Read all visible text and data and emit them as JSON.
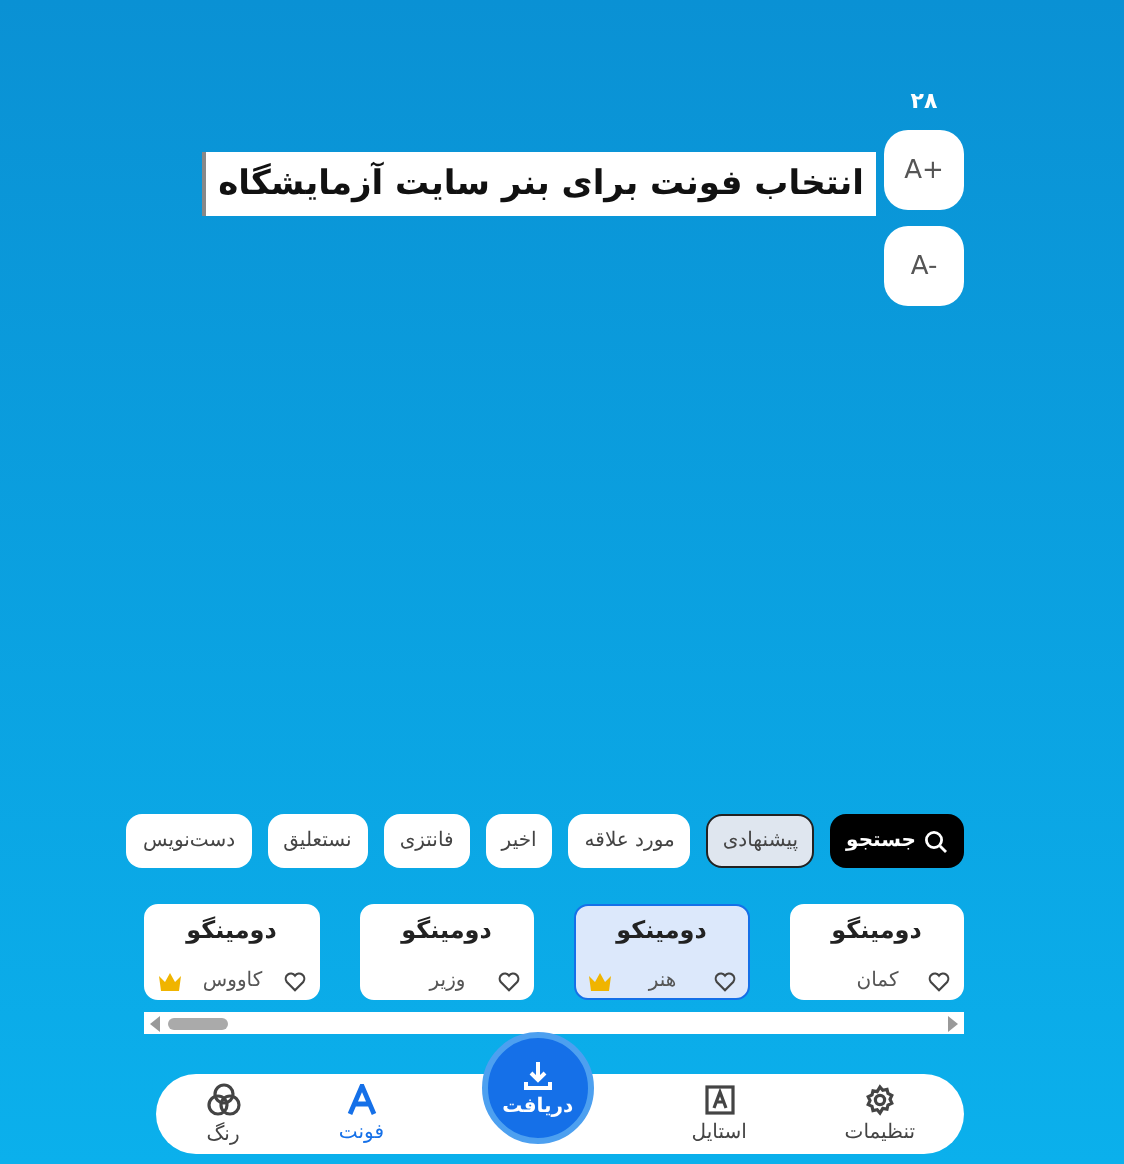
{
  "font_size": "۲۸",
  "preview_text": "انتخاب فونت برای بنر سایت آزمایشگاه",
  "size_buttons": [
    "A+",
    "A-"
  ],
  "search_button": "جستجو",
  "categories": [
    {
      "label": "پیشنهادی",
      "selected": true
    },
    {
      "label": "مورد علاقه",
      "selected": false
    },
    {
      "label": "اخیر",
      "selected": false
    },
    {
      "label": "فانتزی",
      "selected": false
    },
    {
      "label": "نستعلیق",
      "selected": false
    },
    {
      "label": "دست‌نویس",
      "selected": false
    }
  ],
  "fonts": [
    {
      "name": "دومینگو",
      "style": "کمان",
      "selected": false,
      "premium": false
    },
    {
      "name": "دومینکو",
      "style": "هنر",
      "selected": true,
      "premium": true
    },
    {
      "name": "دومینگو",
      "style": "وزیر",
      "selected": false,
      "premium": false
    },
    {
      "name": "دومینگو",
      "style": "کاووس",
      "selected": false,
      "premium": true
    }
  ],
  "nav": [
    {
      "label": "تنظیمات",
      "kind": "settings",
      "selected": false
    },
    {
      "label": "استایل",
      "kind": "style",
      "selected": false
    },
    {
      "label": "دریافت",
      "kind": "download"
    },
    {
      "label": "فونت",
      "kind": "font",
      "selected": true
    },
    {
      "label": "رنگ",
      "kind": "color",
      "selected": false
    }
  ]
}
